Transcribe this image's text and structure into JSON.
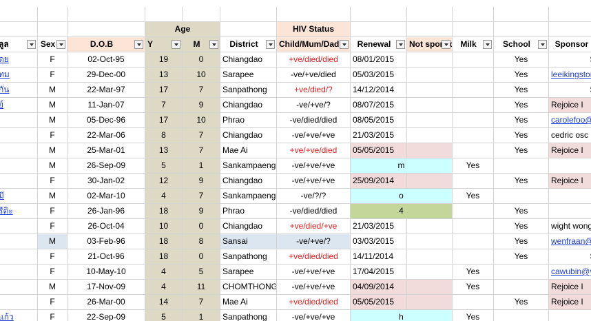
{
  "headers": {
    "group_age": "Age",
    "group_hiv": "HIV Status",
    "row": [
      "ลูล",
      "Sex",
      "D.O.B",
      "Y",
      "M",
      "District",
      "Child/Mum/Dad",
      "Renewal",
      "Not sponsored",
      "Milk",
      "School",
      "Sponsor"
    ]
  },
  "rows": [
    {
      "name": "ดย",
      "sex": "F",
      "dob": "02-Oct-95",
      "y": "19",
      "m": "0",
      "district": "Chiangdao",
      "hiv": "+ve/died/died",
      "hiv_red": true,
      "renewal": "08/01/2015",
      "notsp": "",
      "milk": "",
      "school": "Yes",
      "sponsor": "SD"
    },
    {
      "name": "ทม",
      "sex": "F",
      "dob": "29-Dec-00",
      "y": "13",
      "m": "10",
      "district": "Sarapee",
      "hiv": "-ve/+ve/died",
      "hiv_red": false,
      "renewal": "05/03/2015",
      "notsp": "",
      "milk": "",
      "school": "Yes",
      "sponsor": "leeikingston@"
    },
    {
      "name": "กัน",
      "sex": "M",
      "dob": "22-Mar-97",
      "y": "17",
      "m": "7",
      "district": "Sanpathong",
      "hiv": "+ve/died/?",
      "hiv_red": true,
      "renewal": "14/12/2014",
      "notsp": "",
      "milk": "",
      "school": "Yes",
      "sponsor": "SD"
    },
    {
      "name": "ย์",
      "sex": "M",
      "dob": "11-Jan-07",
      "y": "7",
      "m": "9",
      "district": "Chiangdao",
      "hiv": "-ve/+ve/?",
      "hiv_red": false,
      "renewal": "08/07/2015",
      "notsp": "",
      "milk": "",
      "school": "Yes",
      "sponsor": "Rejoice I"
    },
    {
      "name": "",
      "sex": "M",
      "dob": "05-Dec-96",
      "y": "17",
      "m": "10",
      "district": "Phrao",
      "hiv": "-ve/died/died",
      "hiv_red": false,
      "renewal": "08/05/2015",
      "notsp": "",
      "milk": "",
      "school": "Yes",
      "sponsor": "carolefoo@"
    },
    {
      "name": "",
      "sex": "F",
      "dob": "22-Mar-06",
      "y": "8",
      "m": "7",
      "district": "Chiangdao",
      "hiv": "-ve/+ve/+ve",
      "hiv_red": false,
      "renewal": "21/03/2015",
      "notsp": "",
      "milk": "",
      "school": "Yes",
      "sponsor": "cedric osc <"
    },
    {
      "name": "",
      "sex": "M",
      "dob": "25-Mar-01",
      "y": "13",
      "m": "7",
      "district": "Mae Ai",
      "hiv": "+ve/+ve/died",
      "hiv_red": true,
      "renewal": "05/05/2015",
      "notsp": "",
      "milk": "",
      "school": "Yes",
      "sponsor": "Rejoice I"
    },
    {
      "name": "",
      "sex": "M",
      "dob": "26-Sep-09",
      "y": "5",
      "m": "1",
      "district": "Sankampaeng",
      "hiv": "-ve/+ve/+ve",
      "hiv_red": false,
      "renewal": "",
      "notsp": "m",
      "milk": "Yes",
      "school": "",
      "sponsor": ""
    },
    {
      "name": "",
      "sex": "F",
      "dob": "30-Jan-02",
      "y": "12",
      "m": "9",
      "district": "Chiangdao",
      "hiv": "-ve/+ve/+ve",
      "hiv_red": false,
      "renewal": "25/09/2014",
      "notsp": "",
      "milk": "",
      "school": "Yes",
      "sponsor": "Rejoice I"
    },
    {
      "name": "มี",
      "sex": "M",
      "dob": "02-Mar-10",
      "y": "4",
      "m": "7",
      "district": "Sankampaeng",
      "hiv": "-ve/?/?",
      "hiv_red": false,
      "renewal": "",
      "notsp": "o",
      "milk": "Yes",
      "school": "",
      "sponsor": ""
    },
    {
      "name": "รีติะ",
      "sex": "F",
      "dob": "26-Jan-96",
      "y": "18",
      "m": "9",
      "district": "Phrao",
      "hiv": "-ve/died/died",
      "hiv_red": false,
      "renewal": "",
      "notsp": "4",
      "milk": "",
      "school": "Yes",
      "sponsor": ""
    },
    {
      "name": "",
      "sex": "F",
      "dob": "26-Oct-04",
      "y": "10",
      "m": "0",
      "district": "Chiangdao",
      "hiv": "+ve/died/+ve",
      "hiv_red": true,
      "renewal": "21/03/2015",
      "notsp": "",
      "milk": "",
      "school": "Yes",
      "sponsor": "wight wong"
    },
    {
      "name": "",
      "sex": "M",
      "dob": "03-Feb-96",
      "y": "18",
      "m": "8",
      "district": "Sansai",
      "hiv": "-ve/+ve/?",
      "hiv_red": false,
      "renewal": "03/03/2015",
      "notsp": "",
      "milk": "",
      "school": "Yes",
      "sponsor": "wenfraan@k"
    },
    {
      "name": "",
      "sex": "F",
      "dob": "21-Oct-96",
      "y": "18",
      "m": "0",
      "district": "Sanpathong",
      "hiv": "+ve/died/died",
      "hiv_red": true,
      "renewal": "14/11/2014",
      "notsp": "",
      "milk": "",
      "school": "Yes",
      "sponsor": "SD"
    },
    {
      "name": "",
      "sex": "F",
      "dob": "10-May-10",
      "y": "4",
      "m": "5",
      "district": "Sarapee",
      "hiv": "-ve/+ve/+ve",
      "hiv_red": false,
      "renewal": "17/04/2015",
      "notsp": "",
      "milk": "Yes",
      "school": "",
      "sponsor": "cawubin@y"
    },
    {
      "name": "",
      "sex": "M",
      "dob": "17-Nov-09",
      "y": "4",
      "m": "11",
      "district": "CHOMTHONG",
      "hiv": "-ve/+ve/+ve",
      "hiv_red": false,
      "renewal": "04/09/2014",
      "notsp": "",
      "milk": "Yes",
      "school": "",
      "sponsor": "Rejoice I"
    },
    {
      "name": "",
      "sex": "F",
      "dob": "26-Mar-00",
      "y": "14",
      "m": "7",
      "district": "Mae Ai",
      "hiv": "+ve/died/died",
      "hiv_red": true,
      "renewal": "05/05/2015",
      "notsp": "",
      "milk": "",
      "school": "Yes",
      "sponsor": "Rejoice I"
    },
    {
      "name": "แก้ว",
      "sex": "F",
      "dob": "22-Sep-09",
      "y": "5",
      "m": "1",
      "district": "Sanpathong",
      "hiv": "-ve/+ve/+ve",
      "hiv_red": false,
      "renewal": "",
      "notsp": "h",
      "milk": "Yes",
      "school": "",
      "sponsor": ""
    }
  ],
  "colors": {
    "peach": "#fce4d6",
    "tan": "#ddd9c4",
    "pink": "#f2dcdb",
    "cyan": "#ccffff",
    "green": "#c4d79b",
    "blue": "#dce6f1",
    "red_text": "#e21f1f",
    "link": "#1f3dd6"
  }
}
